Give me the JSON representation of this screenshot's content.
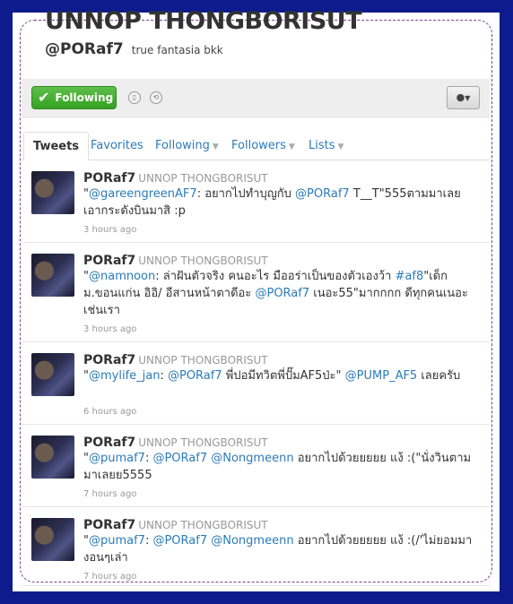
{
  "profile": {
    "full_name": "UNNOP THONGBORISUT",
    "handle": "@PORaf7",
    "bio": "true fantasia bkk"
  },
  "actions": {
    "follow_label": "Following",
    "user_menu_icon": "person-icon"
  },
  "tabs": [
    {
      "label": "Tweets"
    },
    {
      "label": "Favorites"
    },
    {
      "label": "Following"
    },
    {
      "label": "Followers"
    },
    {
      "label": "Lists"
    }
  ],
  "tweets": [
    {
      "username": "PORaf7",
      "fullname": "UNNOP THONGBORISUT",
      "parts": [
        "\"",
        "@gareengreenAF7",
        ": อยากไปทำบุญกับ ",
        "@PORaf7",
        " T__T\"555ตามมาเลย เอากระดังบินมาสิ :p"
      ],
      "time": "3 hours ago"
    },
    {
      "username": "PORaf7",
      "fullname": "UNNOP THONGBORISUT",
      "parts": [
        "\"",
        "@namnoon",
        ": ล่าฝันตัวจริง คนอะไร มืออร่าเป็นของตัวเองว้า ",
        "#af8",
        "\"เด็ก ม.ขอนแก่น อิอิ/ อีสานหน้าตาดีอะ ",
        "@PORaf7",
        " เนอะ55\"มากกกก ดีทุกคนเนอะเช่นเรา"
      ],
      "time": "3 hours ago"
    },
    {
      "username": "PORaf7",
      "fullname": "UNNOP THONGBORISUT",
      "parts": [
        "\"",
        "@mylife_jan",
        ": ",
        "@PORaf7",
        " พี่ปอมีทวิตพี่ปั๊มAF5ป่ะ\" ",
        "@PUMP_AF5",
        " เลยครับ"
      ],
      "time": "6 hours ago"
    },
    {
      "username": "PORaf7",
      "fullname": "UNNOP THONGBORISUT",
      "parts": [
        "\"",
        "@pumaf7",
        ": ",
        "@PORaf7",
        " ",
        "@Nongmeenn",
        " อยากไปด้วยยยยย แง้ :(\"นั่งวินตามมาเลยย5555"
      ],
      "time": "7 hours ago"
    },
    {
      "username": "PORaf7",
      "fullname": "UNNOP THONGBORISUT",
      "parts": [
        "\"",
        "@pumaf7",
        ": ",
        "@PORaf7",
        " ",
        "@Nongmeenn",
        " อยากไปด้วยยยยย แง้ :(/'ไม่ยอมมา งอนๆเล่า"
      ],
      "time": "7 hours ago"
    }
  ],
  "colors": {
    "background": "#0d1b8c",
    "follow_green": "#35a121",
    "link_blue": "#2b7bb9"
  }
}
